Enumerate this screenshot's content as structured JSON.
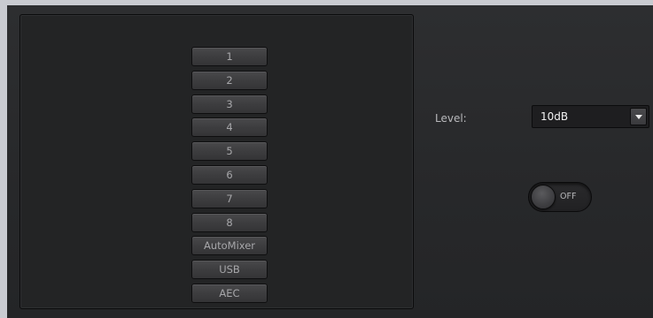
{
  "channels": [
    {
      "label": "1"
    },
    {
      "label": "2"
    },
    {
      "label": "3"
    },
    {
      "label": "4"
    },
    {
      "label": "5"
    },
    {
      "label": "6"
    },
    {
      "label": "7"
    },
    {
      "label": "8"
    },
    {
      "label": "AutoMixer"
    },
    {
      "label": "USB"
    },
    {
      "label": "AEC"
    }
  ],
  "level": {
    "label": "Level:",
    "value": "10dB",
    "dropdown_icon": "chevron-down-icon"
  },
  "toggle": {
    "state_label": "OFF",
    "state": "off"
  },
  "colors": {
    "background": "#2b2c2e",
    "panel": "#232425",
    "button": "#3d3d3f",
    "text": "#a7a7aa",
    "select_text": "#f2f2f2"
  }
}
